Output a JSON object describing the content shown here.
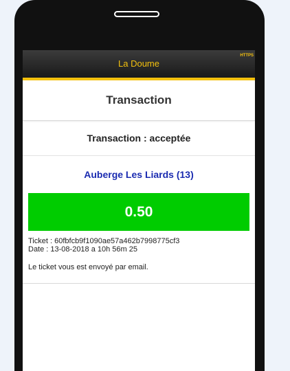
{
  "app": {
    "title": "La Doume",
    "https_badge": "HTTPS"
  },
  "page": {
    "heading": "Transaction",
    "status_text": "Transaction : acceptée",
    "merchant": "Auberge Les Liards (13)",
    "amount": "0.50"
  },
  "ticket": {
    "ticket_line": "Ticket : 60fbfcb9f1090ae57a462b7998775cf3",
    "date_line": "Date : 13-08-2018 a 10h 56m 25",
    "email_note": "Le ticket vous est envoyé par email."
  },
  "colors": {
    "accent": "#f4c10e",
    "amount_bg": "#00cc00",
    "merchant_text": "#1a2bb0",
    "header_bg": "#2a2a2a"
  }
}
